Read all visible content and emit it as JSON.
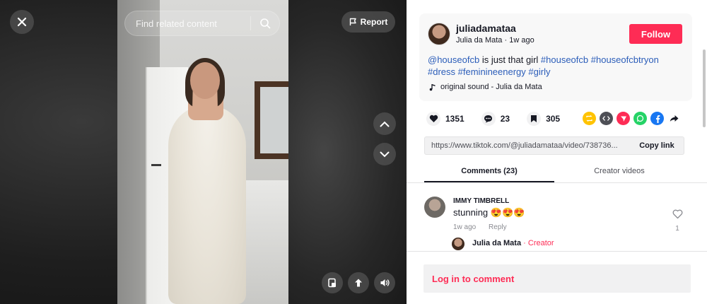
{
  "video": {
    "search_placeholder": "Find related content",
    "report_label": "Report"
  },
  "post": {
    "username": "juliadamataa",
    "display_name": "Julia da Mata",
    "time_ago": "1w ago",
    "follow_label": "Follow",
    "caption_parts": {
      "mention": "@houseofcb",
      "text": " is just that girl ",
      "tag1": "#houseofcb",
      "tag2": "#houseofcbtryon",
      "tag3": "#dress",
      "tag4": "#feminineenergy",
      "tag5": "#girly"
    },
    "sound": "original sound - Julia da Mata"
  },
  "stats": {
    "likes": "1351",
    "comments": "23",
    "saves": "305"
  },
  "share": {
    "link": "https://www.tiktok.com/@juliadamataa/video/738736...",
    "copy_label": "Copy link"
  },
  "tabs": [
    {
      "label": "Comments (23)"
    },
    {
      "label": "Creator videos"
    }
  ],
  "comments": [
    {
      "author": "IMMY TIMBRELL",
      "text": "stunning",
      "emoji": "😍😍😍",
      "time": "1w ago",
      "reply_label": "Reply",
      "likes": "1",
      "reply": {
        "author": "Julia da Mata",
        "badge": "Creator"
      }
    }
  ],
  "login": {
    "label": "Log in to comment"
  },
  "colors": {
    "accent": "#fe2c55",
    "tag": "#2b5db9"
  }
}
